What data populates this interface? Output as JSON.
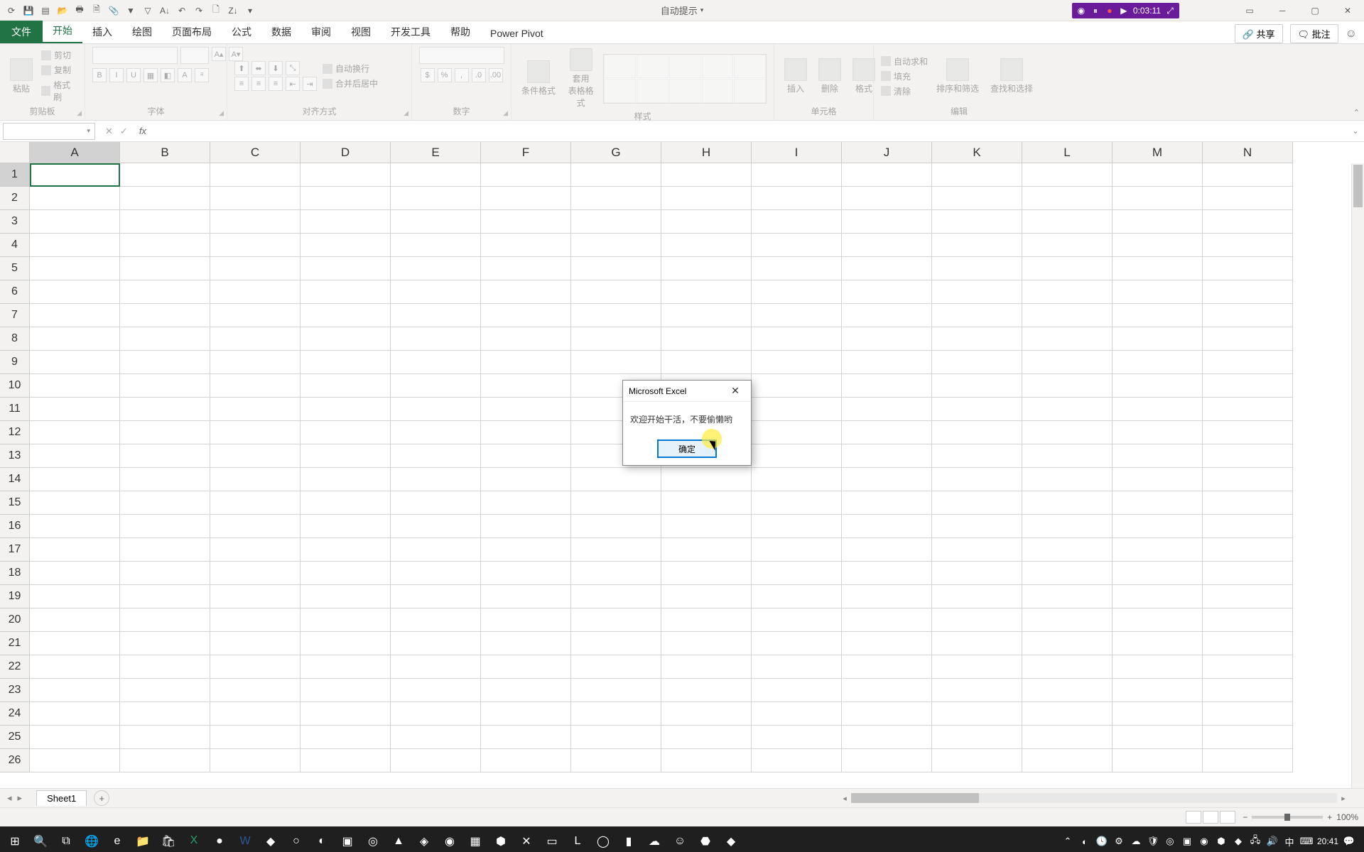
{
  "title": "自动提示",
  "recorder": {
    "time": "0:03:11"
  },
  "window": {
    "min": "─",
    "max": "▢",
    "close": "✕",
    "rib": "▭"
  },
  "tabs": {
    "file": "文件",
    "items": [
      "开始",
      "插入",
      "绘图",
      "页面布局",
      "公式",
      "数据",
      "审阅",
      "视图",
      "开发工具",
      "帮助",
      "Power Pivot"
    ],
    "active": "开始",
    "share": "共享",
    "notes": "批注"
  },
  "ribbon": {
    "clipboard": {
      "paste": "粘贴",
      "cut": "剪切",
      "copy": "复制",
      "fmt": "格式刷",
      "label": "剪贴板"
    },
    "font": {
      "label": "字体",
      "bold": "B",
      "italic": "I",
      "underline": "U"
    },
    "align": {
      "wrap": "自动换行",
      "merge": "合并后居中",
      "label": "对齐方式"
    },
    "number": {
      "label": "数字"
    },
    "styles": {
      "cond": "条件格式",
      "table": "套用\n表格格式",
      "label": "样式"
    },
    "cells": {
      "ins": "插入",
      "del": "删除",
      "fmt": "格式",
      "label": "单元格"
    },
    "edit": {
      "sum": "自动求和",
      "fill": "填充",
      "clear": "清除",
      "sort": "排序和筛选",
      "find": "查找和选择",
      "label": "编辑"
    }
  },
  "fbar": {
    "name": "",
    "fx": "fx"
  },
  "cols": [
    "A",
    "B",
    "C",
    "D",
    "E",
    "F",
    "G",
    "H",
    "I",
    "J",
    "K",
    "L",
    "M",
    "N"
  ],
  "rows": [
    "1",
    "2",
    "3",
    "4",
    "5",
    "6",
    "7",
    "8",
    "9",
    "10",
    "11",
    "12",
    "13",
    "14",
    "15",
    "16",
    "17",
    "18",
    "19",
    "20",
    "21",
    "22",
    "23",
    "24",
    "25",
    "26"
  ],
  "sheet": {
    "nav": [
      "◂",
      "▸"
    ],
    "tab": "Sheet1",
    "add": "+"
  },
  "status": {
    "ready": "",
    "zoom": "100%"
  },
  "dialog": {
    "title": "Microsoft Excel",
    "msg": "欢迎开始干活，不要偷懒哟",
    "ok": "确定"
  },
  "tray": {
    "ime": "中",
    "time": "20:41"
  }
}
